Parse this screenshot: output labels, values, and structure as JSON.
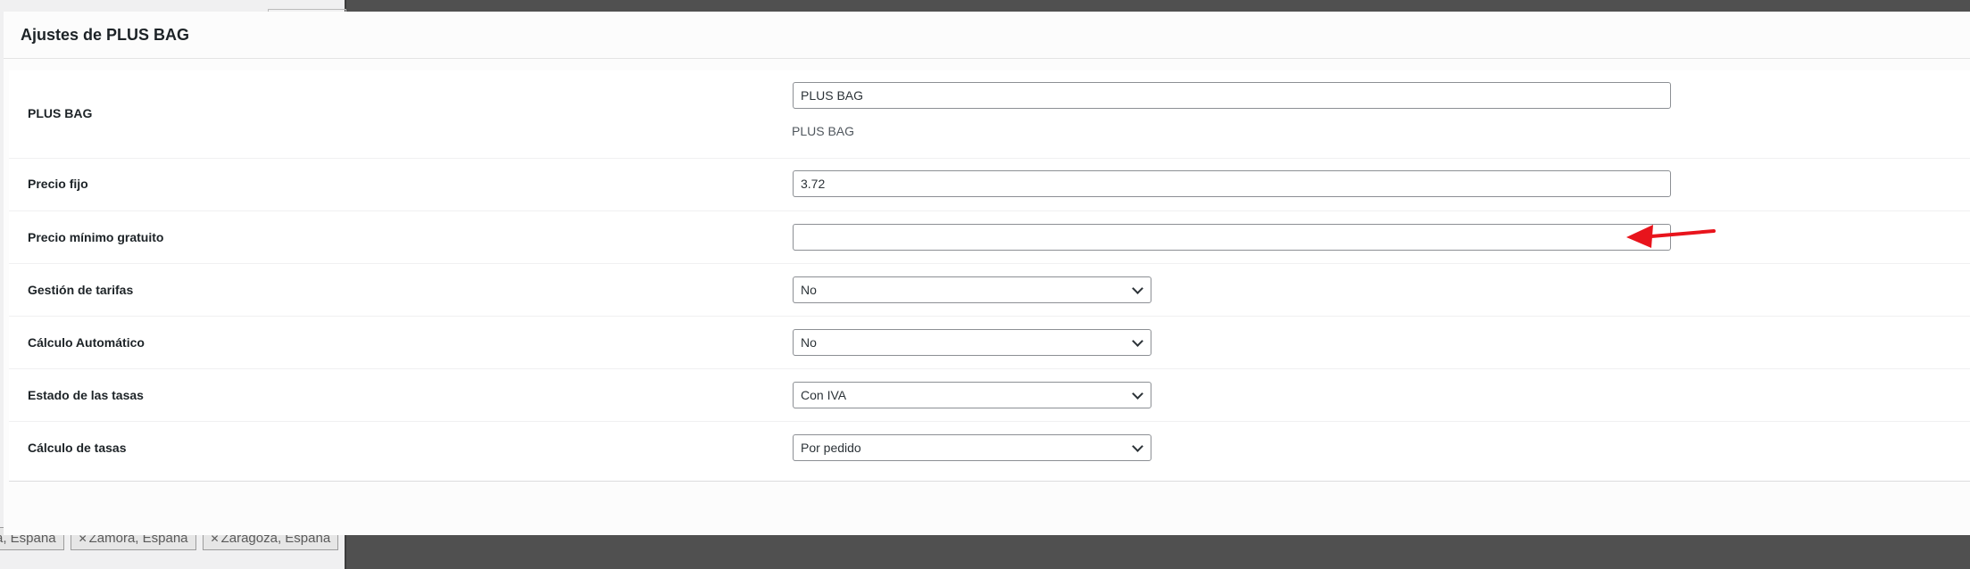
{
  "modal": {
    "title": "Ajustes de PLUS BAG"
  },
  "fields": {
    "plus_bag": {
      "label": "PLUS BAG",
      "value": "PLUS BAG",
      "help": "PLUS BAG"
    },
    "precio_fijo": {
      "label": "Precio fijo",
      "value": "3.72"
    },
    "precio_minimo": {
      "label": "Precio mínimo gratuito",
      "value": ""
    },
    "gestion_tarifas": {
      "label": "Gestión de tarifas",
      "selected": "No"
    },
    "calculo_automatico": {
      "label": "Cálculo Automático",
      "selected": "No"
    },
    "estado_tasas": {
      "label": "Estado de las tasas",
      "selected": "Con IVA"
    },
    "calculo_tasas": {
      "label": "Cálculo de tasas",
      "selected": "Por pedido"
    }
  },
  "background_tags": [
    "a, España",
    "Zamora, España",
    "Zaragoza, España"
  ],
  "colors": {
    "annotation_arrow": "#e8141c",
    "overlay": "#505050"
  },
  "icons": {
    "select_arrow": "chevron-down-icon",
    "tag_remove": "close-icon",
    "annotation": "red-arrow-icon"
  }
}
